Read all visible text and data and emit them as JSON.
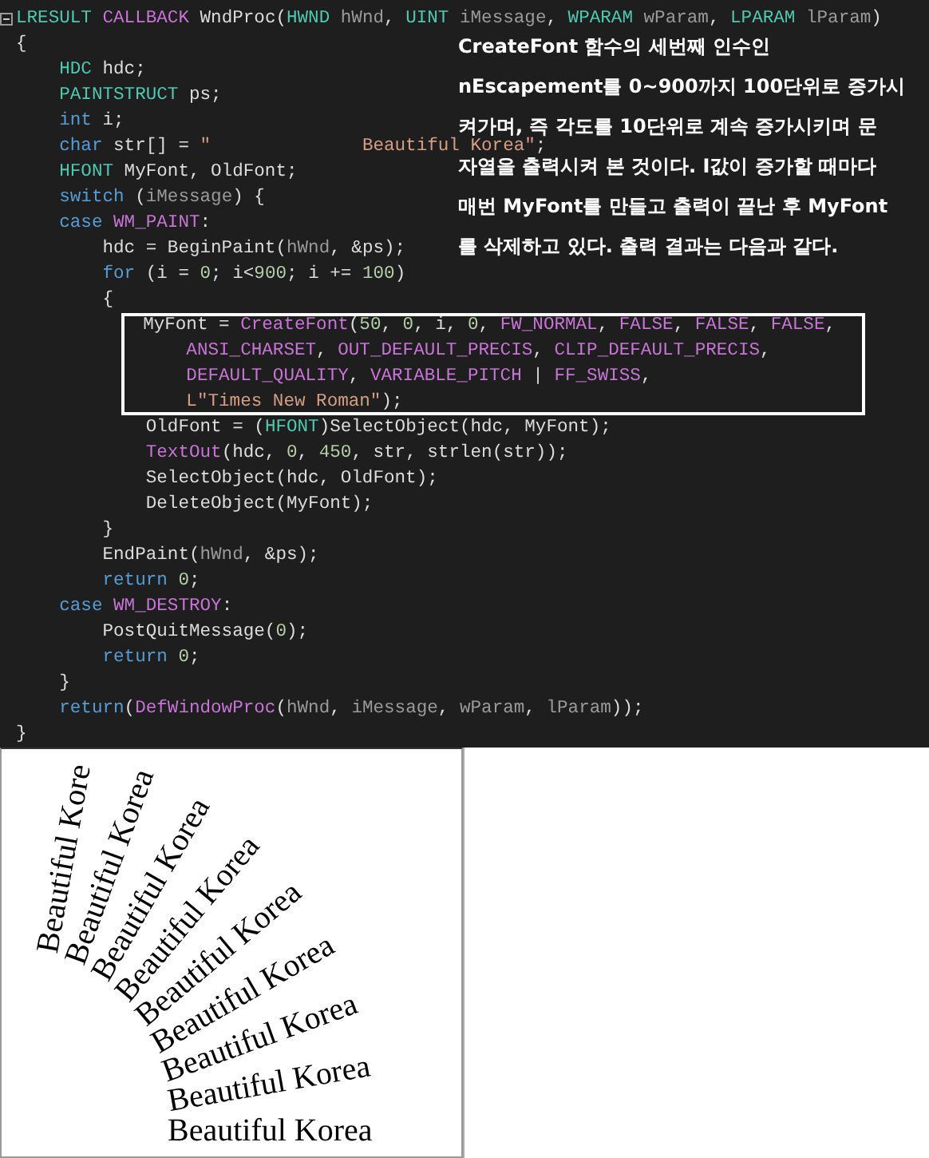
{
  "editor": {
    "lines": [
      {
        "highlighted": false,
        "tokens": [
          {
            "kind": "type",
            "text": "LRESULT"
          },
          {
            "kind": "macro",
            "text": " CALLBACK"
          },
          {
            "kind": "plain",
            "text": " WndProc("
          },
          {
            "kind": "type",
            "text": "HWND"
          },
          {
            "kind": "param",
            "text": " hWnd"
          },
          {
            "kind": "plain",
            "text": ", "
          },
          {
            "kind": "type",
            "text": "UINT"
          },
          {
            "kind": "param",
            "text": " iMessage"
          },
          {
            "kind": "plain",
            "text": ", "
          },
          {
            "kind": "type",
            "text": "WPARAM"
          },
          {
            "kind": "param",
            "text": " wParam"
          },
          {
            "kind": "plain",
            "text": ", "
          },
          {
            "kind": "type",
            "text": "LPARAM"
          },
          {
            "kind": "param",
            "text": " lParam"
          },
          {
            "kind": "plain",
            "text": ")"
          }
        ]
      },
      {
        "highlighted": false,
        "tokens": [
          {
            "kind": "plain",
            "text": "{"
          }
        ]
      },
      {
        "highlighted": false,
        "tokens": [
          {
            "kind": "type",
            "text": "    HDC"
          },
          {
            "kind": "plain",
            "text": " hdc;"
          }
        ]
      },
      {
        "highlighted": false,
        "tokens": [
          {
            "kind": "type",
            "text": "    PAINTSTRUCT"
          },
          {
            "kind": "plain",
            "text": " ps;"
          }
        ]
      },
      {
        "highlighted": false,
        "tokens": [
          {
            "kind": "keyword",
            "text": "    int"
          },
          {
            "kind": "plain",
            "text": " i;"
          }
        ]
      },
      {
        "highlighted": false,
        "tokens": [
          {
            "kind": "keyword",
            "text": "    char"
          },
          {
            "kind": "plain",
            "text": " str[] = "
          },
          {
            "kind": "string",
            "text": "\"              Beautiful Korea\""
          },
          {
            "kind": "plain",
            "text": ";"
          }
        ]
      },
      {
        "highlighted": false,
        "tokens": [
          {
            "kind": "type",
            "text": "    HFONT"
          },
          {
            "kind": "plain",
            "text": " MyFont, OldFont;"
          }
        ]
      },
      {
        "highlighted": false,
        "tokens": [
          {
            "kind": "keyword",
            "text": "    switch"
          },
          {
            "kind": "plain",
            "text": " ("
          },
          {
            "kind": "param",
            "text": "iMessage"
          },
          {
            "kind": "plain",
            "text": ") {"
          }
        ]
      },
      {
        "highlighted": false,
        "tokens": [
          {
            "kind": "keyword",
            "text": "    case"
          },
          {
            "kind": "macro",
            "text": " WM_PAINT"
          },
          {
            "kind": "plain",
            "text": ":"
          }
        ]
      },
      {
        "highlighted": false,
        "tokens": [
          {
            "kind": "plain",
            "text": "        hdc = BeginPaint("
          },
          {
            "kind": "param",
            "text": "hWnd"
          },
          {
            "kind": "plain",
            "text": ", &ps);"
          }
        ]
      },
      {
        "highlighted": false,
        "tokens": [
          {
            "kind": "keyword",
            "text": "        for"
          },
          {
            "kind": "plain",
            "text": " (i = "
          },
          {
            "kind": "number",
            "text": "0"
          },
          {
            "kind": "plain",
            "text": "; i<"
          },
          {
            "kind": "number",
            "text": "900"
          },
          {
            "kind": "plain",
            "text": "; i += "
          },
          {
            "kind": "number",
            "text": "100"
          },
          {
            "kind": "plain",
            "text": ")"
          }
        ]
      },
      {
        "highlighted": false,
        "tokens": [
          {
            "kind": "plain",
            "text": "        {"
          }
        ]
      },
      {
        "highlighted": true,
        "tokens": [
          {
            "kind": "plain",
            "text": "            MyFont = "
          },
          {
            "kind": "macro",
            "text": "CreateFont"
          },
          {
            "kind": "plain",
            "text": "("
          },
          {
            "kind": "number",
            "text": "50"
          },
          {
            "kind": "plain",
            "text": ", "
          },
          {
            "kind": "number",
            "text": "0"
          },
          {
            "kind": "plain",
            "text": ", i, "
          },
          {
            "kind": "number",
            "text": "0"
          },
          {
            "kind": "plain",
            "text": ", "
          },
          {
            "kind": "macro",
            "text": "FW_NORMAL"
          },
          {
            "kind": "plain",
            "text": ", "
          },
          {
            "kind": "macro",
            "text": "FALSE"
          },
          {
            "kind": "plain",
            "text": ", "
          },
          {
            "kind": "macro",
            "text": "FALSE"
          },
          {
            "kind": "plain",
            "text": ", "
          },
          {
            "kind": "macro",
            "text": "FALSE"
          },
          {
            "kind": "plain",
            "text": ","
          }
        ]
      },
      {
        "highlighted": true,
        "tokens": [
          {
            "kind": "macro",
            "text": "                ANSI_CHARSET"
          },
          {
            "kind": "plain",
            "text": ", "
          },
          {
            "kind": "macro",
            "text": "OUT_DEFAULT_PRECIS"
          },
          {
            "kind": "plain",
            "text": ", "
          },
          {
            "kind": "macro",
            "text": "CLIP_DEFAULT_PRECIS"
          },
          {
            "kind": "plain",
            "text": ","
          }
        ]
      },
      {
        "highlighted": true,
        "tokens": [
          {
            "kind": "macro",
            "text": "                DEFAULT_QUALITY"
          },
          {
            "kind": "plain",
            "text": ", "
          },
          {
            "kind": "macro",
            "text": "VARIABLE_PITCH"
          },
          {
            "kind": "plain",
            "text": " | "
          },
          {
            "kind": "macro",
            "text": "FF_SWISS"
          },
          {
            "kind": "plain",
            "text": ","
          }
        ]
      },
      {
        "highlighted": true,
        "tokens": [
          {
            "kind": "string",
            "text": "                L\"Times New Roman\""
          },
          {
            "kind": "plain",
            "text": ");"
          }
        ]
      },
      {
        "highlighted": false,
        "tokens": [
          {
            "kind": "plain",
            "text": "            OldFont = ("
          },
          {
            "kind": "type",
            "text": "HFONT"
          },
          {
            "kind": "plain",
            "text": ")SelectObject(hdc, MyFont);"
          }
        ]
      },
      {
        "highlighted": false,
        "tokens": [
          {
            "kind": "macro",
            "text": "            TextOut"
          },
          {
            "kind": "plain",
            "text": "(hdc, "
          },
          {
            "kind": "number",
            "text": "0"
          },
          {
            "kind": "plain",
            "text": ", "
          },
          {
            "kind": "number",
            "text": "450"
          },
          {
            "kind": "plain",
            "text": ", str, strlen(str));"
          }
        ]
      },
      {
        "highlighted": false,
        "tokens": [
          {
            "kind": "plain",
            "text": "            SelectObject(hdc, OldFont);"
          }
        ]
      },
      {
        "highlighted": false,
        "tokens": [
          {
            "kind": "plain",
            "text": "            DeleteObject(MyFont);"
          }
        ]
      },
      {
        "highlighted": false,
        "tokens": [
          {
            "kind": "plain",
            "text": "        }"
          }
        ]
      },
      {
        "highlighted": false,
        "tokens": [
          {
            "kind": "plain",
            "text": "        EndPaint("
          },
          {
            "kind": "param",
            "text": "hWnd"
          },
          {
            "kind": "plain",
            "text": ", &ps);"
          }
        ]
      },
      {
        "highlighted": false,
        "tokens": [
          {
            "kind": "keyword",
            "text": "        return"
          },
          {
            "kind": "number",
            "text": " 0"
          },
          {
            "kind": "plain",
            "text": ";"
          }
        ]
      },
      {
        "highlighted": false,
        "tokens": [
          {
            "kind": "keyword",
            "text": "    case"
          },
          {
            "kind": "macro",
            "text": " WM_DESTROY"
          },
          {
            "kind": "plain",
            "text": ":"
          }
        ]
      },
      {
        "highlighted": false,
        "tokens": [
          {
            "kind": "plain",
            "text": "        PostQuitMessage("
          },
          {
            "kind": "number",
            "text": "0"
          },
          {
            "kind": "plain",
            "text": ");"
          }
        ]
      },
      {
        "highlighted": false,
        "tokens": [
          {
            "kind": "keyword",
            "text": "        return"
          },
          {
            "kind": "number",
            "text": " 0"
          },
          {
            "kind": "plain",
            "text": ";"
          }
        ]
      },
      {
        "highlighted": false,
        "tokens": [
          {
            "kind": "plain",
            "text": "    }"
          }
        ]
      },
      {
        "highlighted": false,
        "tokens": [
          {
            "kind": "keyword",
            "text": "    return"
          },
          {
            "kind": "plain",
            "text": "("
          },
          {
            "kind": "macro",
            "text": "DefWindowProc"
          },
          {
            "kind": "plain",
            "text": "("
          },
          {
            "kind": "param",
            "text": "hWnd"
          },
          {
            "kind": "plain",
            "text": ", "
          },
          {
            "kind": "param",
            "text": "iMessage"
          },
          {
            "kind": "plain",
            "text": ", "
          },
          {
            "kind": "param",
            "text": "wParam"
          },
          {
            "kind": "plain",
            "text": ", "
          },
          {
            "kind": "param",
            "text": "lParam"
          },
          {
            "kind": "plain",
            "text": "));"
          }
        ]
      },
      {
        "highlighted": false,
        "tokens": [
          {
            "kind": "plain",
            "text": "}"
          }
        ]
      }
    ]
  },
  "note": {
    "lines": [
      "CreateFont 함수의 세번째 인수인",
      "nEscapement를 0~900까지 100단위로 증가시",
      "켜가며, 즉 각도를 10단위로 계속 증가시키며 문",
      "자열을 출력시켜 본 것이다. I값이 증가할 때마다",
      "매번 MyFont를 만들고 출력이 끝난 후 MyFont",
      "를 삭제하고 있다. 출력 결과는 다음과 같다."
    ]
  },
  "output": {
    "texts": [
      "Beautiful Korea",
      "Beautiful Korea",
      "Beautiful Korea",
      "Beautiful Korea",
      "Beautiful Korea",
      "Beautiful Korea",
      "Beautiful Korea",
      "Beautiful Korea",
      "Beautiful Kore"
    ]
  }
}
